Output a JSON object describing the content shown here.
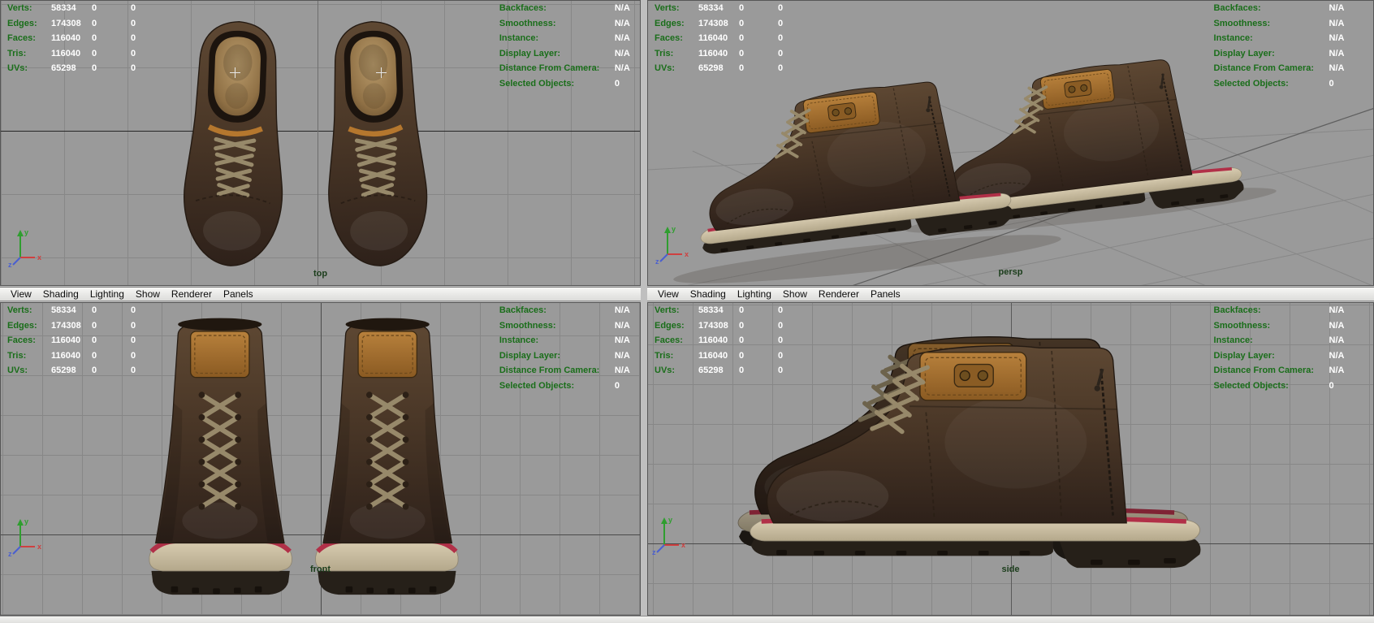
{
  "hud": {
    "left_rows": [
      {
        "label": "Verts:",
        "v1": "58334",
        "v2": "0",
        "v3": "0"
      },
      {
        "label": "Edges:",
        "v1": "174308",
        "v2": "0",
        "v3": "0"
      },
      {
        "label": "Faces:",
        "v1": "116040",
        "v2": "0",
        "v3": "0"
      },
      {
        "label": "Tris:",
        "v1": "116040",
        "v2": "0",
        "v3": "0"
      },
      {
        "label": "UVs:",
        "v1": "65298",
        "v2": "0",
        "v3": "0"
      }
    ],
    "right_rows": [
      {
        "label": "Backfaces:",
        "value": "N/A"
      },
      {
        "label": "Smoothness:",
        "value": "N/A"
      },
      {
        "label": "Instance:",
        "value": "N/A"
      },
      {
        "label": "Display Layer:",
        "value": "N/A"
      },
      {
        "label": "Distance From Camera:",
        "value": "N/A"
      },
      {
        "label": "Selected Objects:",
        "value": "0"
      }
    ]
  },
  "menu": {
    "items": [
      {
        "label": "View"
      },
      {
        "label": "Shading"
      },
      {
        "label": "Lighting"
      },
      {
        "label": "Show"
      },
      {
        "label": "Renderer"
      },
      {
        "label": "Panels"
      }
    ]
  },
  "viewports": {
    "top": {
      "label": "top"
    },
    "persp": {
      "label": "persp"
    },
    "front": {
      "label": "front"
    },
    "side": {
      "label": "side"
    }
  },
  "axis": {
    "x": "x",
    "y": "y",
    "z": "z"
  },
  "colors": {
    "hud_label_green": "#1a6e1a",
    "hud_value_white": "#ffffff",
    "viewport_bg": "#9a9a9a",
    "grid_line": "#878787",
    "axis_x_red": "#cf4040",
    "axis_y_green": "#2f9e2f",
    "axis_z_blue": "#4a5fd0",
    "view_label_green": "#1b3d1b",
    "boot_leather_brown": "#4a3727",
    "boot_collar_tan": "#a06c2c",
    "boot_sole_cream": "#cfc3a6",
    "boot_sole_red": "#b13048"
  }
}
